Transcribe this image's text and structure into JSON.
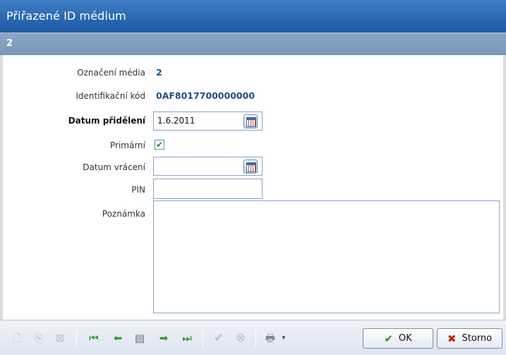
{
  "window": {
    "title": "Přiřazené ID médium",
    "record_number": "2"
  },
  "form": {
    "media_label": {
      "label": "Označení média",
      "value": "2"
    },
    "identification_code": {
      "label": "Identifikační kód",
      "value": "0AF8017700000000"
    },
    "assignment_date": {
      "label": "Datum přidělení",
      "value": "1.6.2011"
    },
    "primary": {
      "label": "Primární",
      "checked": true,
      "mark": "✔"
    },
    "return_date": {
      "label": "Datum vrácení",
      "value": ""
    },
    "pin": {
      "label": "PIN",
      "value": ""
    },
    "note": {
      "label": "Poznámka",
      "value": ""
    }
  },
  "toolbar": {
    "icons": {
      "new": "page-icon",
      "copy": "copy-icon",
      "delete": "delete-icon",
      "first": "first-record-icon",
      "prev": "prev-record-icon",
      "detail": "detail-icon",
      "next": "next-record-icon",
      "last": "last-record-icon",
      "confirm": "confirm-icon",
      "cancel": "cancel-icon",
      "print": "print-icon"
    },
    "ok_label": "OK",
    "cancel_label": "Storno"
  },
  "colors": {
    "title_bar": "#2b68b2",
    "sub_bar": "#7b98bb",
    "value_text": "#1b4f84",
    "nav_green": "#3c9a3c",
    "storno_red": "#c0241b"
  }
}
